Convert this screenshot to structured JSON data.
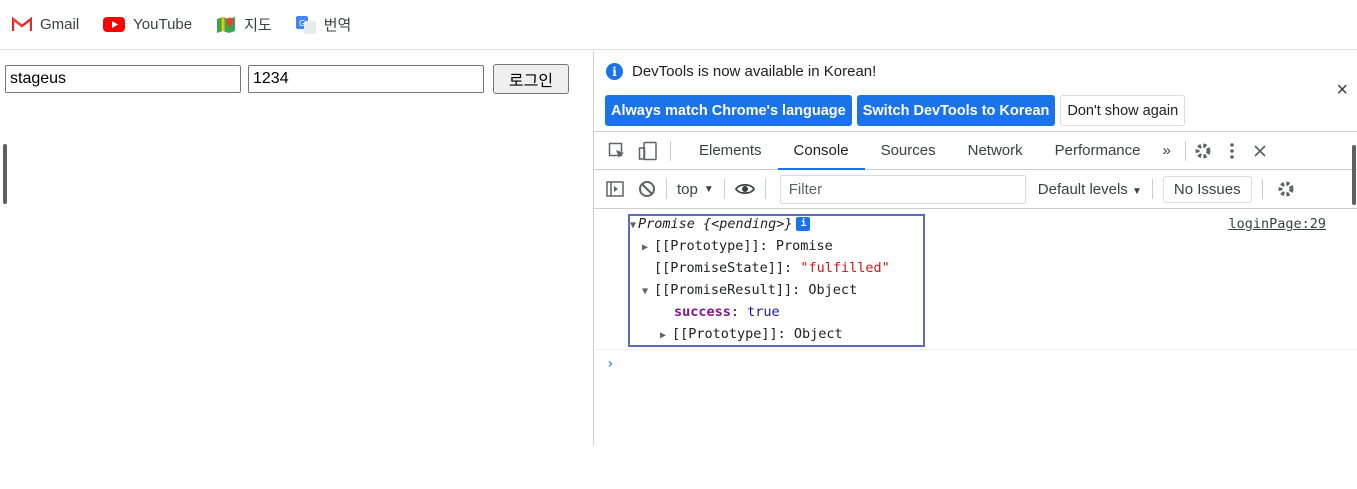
{
  "bookmarks": [
    {
      "label": "Gmail",
      "icon": "gmail-icon"
    },
    {
      "label": "YouTube",
      "icon": "youtube-icon"
    },
    {
      "label": "지도",
      "icon": "maps-icon"
    },
    {
      "label": "번역",
      "icon": "translate-icon"
    }
  ],
  "login": {
    "id_value": "stageus",
    "pw_value": "1234",
    "button_label": "로그인"
  },
  "devtools": {
    "infobar": {
      "message": "DevTools is now available in Korean!",
      "btn_match": "Always match Chrome's language",
      "btn_switch": "Switch DevTools to Korean",
      "btn_dismiss": "Don't show again",
      "close": "×"
    },
    "tabs": [
      "Elements",
      "Console",
      "Sources",
      "Network",
      "Performance"
    ],
    "active_tab": "Console",
    "more_tabs": "»",
    "console_toolbar": {
      "context": "top",
      "filter_placeholder": "Filter",
      "levels": "Default levels",
      "issues": "No Issues"
    },
    "log": {
      "source": "loginPage:29",
      "lines": {
        "promise_label": "Promise",
        "promise_state_inline": "{<pending>}",
        "proto1": "[[Prototype]]: Promise",
        "state_key": "[[PromiseState]]: ",
        "state_val": "\"fulfilled\"",
        "result": "[[PromiseResult]]: Object",
        "success_key": "success",
        "success_val": "true",
        "proto2": "[[Prototype]]: Object"
      }
    },
    "prompt": "›"
  },
  "colors": {
    "accent": "#1a73e8",
    "highlight_border": "#5c6bc0",
    "string": "#c41a16",
    "keyword": "#881391"
  }
}
